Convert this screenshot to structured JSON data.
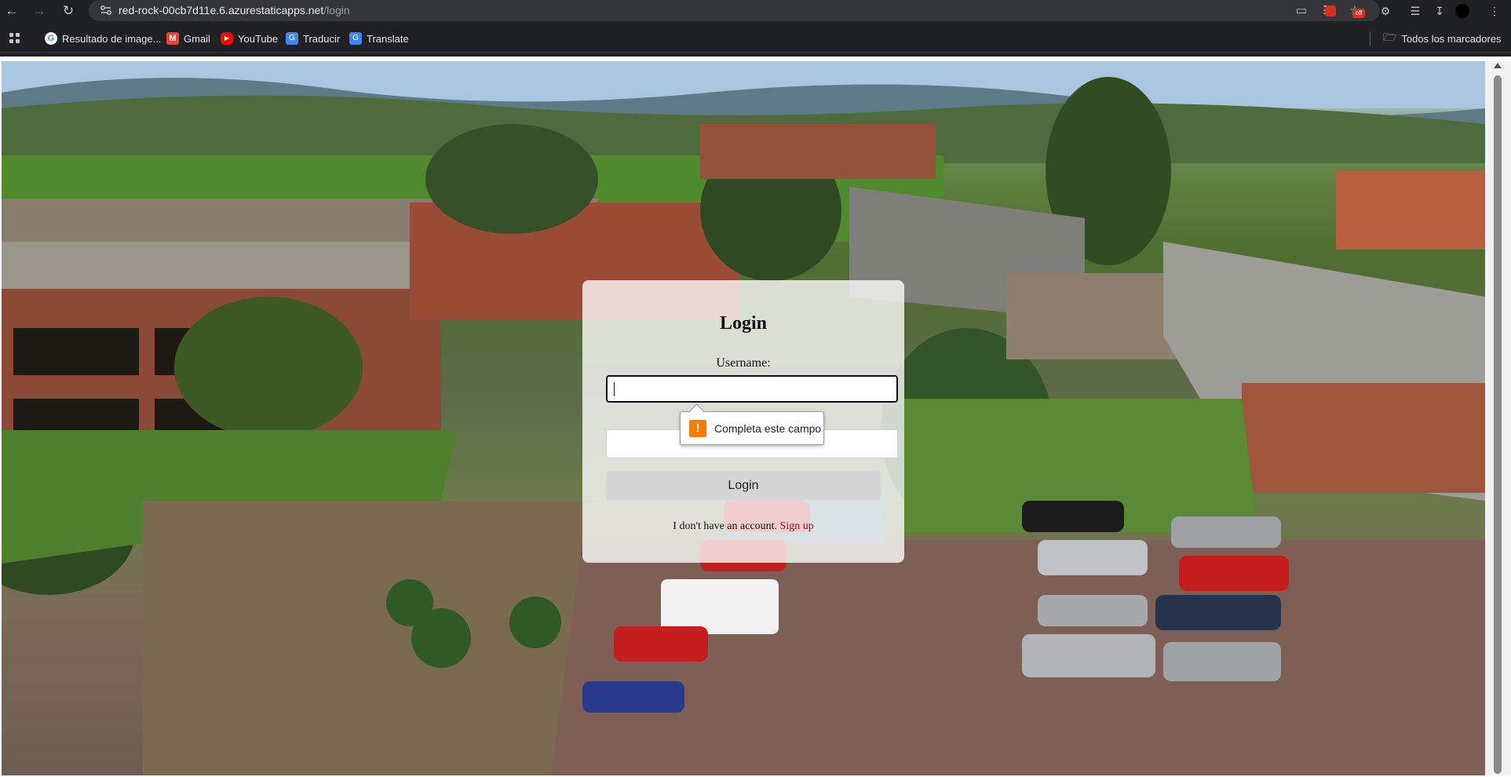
{
  "browser": {
    "url_host": "red-rock-00cb7d11e.6.azurestaticapps.net",
    "url_path": "/login",
    "bookmarks": [
      {
        "label": "Resultado de image...",
        "icon": "google-icon",
        "color": "#ffffff"
      },
      {
        "label": "Gmail",
        "icon": "gmail-icon",
        "color": "#ea4335"
      },
      {
        "label": "YouTube",
        "icon": "youtube-icon",
        "color": "#ff0000"
      },
      {
        "label": "Traducir",
        "icon": "translate-icon",
        "color": "#4285f4"
      },
      {
        "label": "Translate",
        "icon": "translate-icon",
        "color": "#4285f4"
      }
    ],
    "all_bookmarks": "Todos los marcadores"
  },
  "login": {
    "title": "Login",
    "username_label": "Username:",
    "username_value": "",
    "button": "Login",
    "no_account_text": "I don't have an account.",
    "signup_link": "Sign up",
    "link_color": "#b00020"
  },
  "validation": {
    "message": "Completa este campo",
    "icon": "warning-icon",
    "icon_color": "#f57c00"
  }
}
